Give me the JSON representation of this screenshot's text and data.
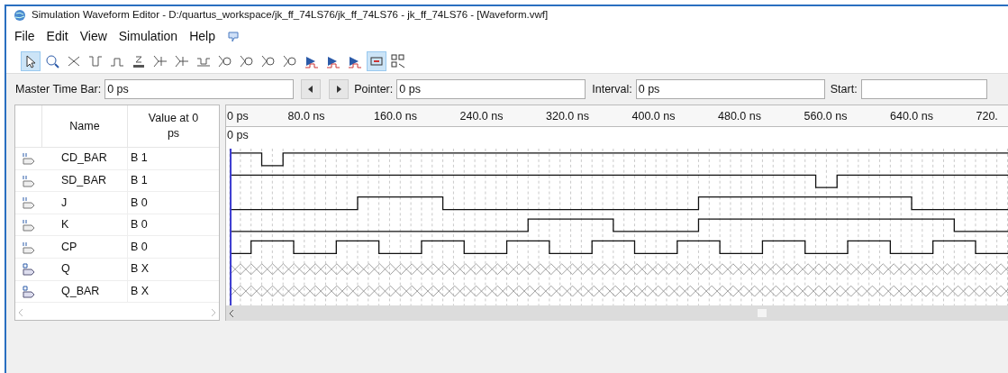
{
  "window": {
    "title": "Simulation Waveform Editor - D:/quartus_workspace/jk_ff_74LS76/jk_ff_74LS76 - jk_ff_74LS76 - [Waveform.vwf]"
  },
  "menu": [
    "File",
    "Edit",
    "View",
    "Simulation",
    "Help"
  ],
  "toolbar": [
    {
      "kind": "pointer",
      "selected": true
    },
    {
      "kind": "zoom",
      "selected": false
    },
    {
      "kind": "unknown",
      "selected": false
    },
    {
      "kind": "low",
      "selected": false
    },
    {
      "kind": "high",
      "selected": false
    },
    {
      "kind": "hiz",
      "selected": false
    },
    {
      "kind": "weak",
      "selected": false
    },
    {
      "kind": "weak",
      "selected": false
    },
    {
      "kind": "invert",
      "selected": false
    },
    {
      "kind": "bus",
      "selected": false
    },
    {
      "kind": "bus",
      "selected": false
    },
    {
      "kind": "bus",
      "selected": false
    },
    {
      "kind": "bus",
      "selected": false
    },
    {
      "kind": "sim",
      "selected": false
    },
    {
      "kind": "sim",
      "selected": false
    },
    {
      "kind": "sim",
      "selected": false
    },
    {
      "kind": "snap",
      "selected": true
    },
    {
      "kind": "grid",
      "selected": false
    }
  ],
  "time_bar": {
    "master_label": "Master Time Bar:",
    "master_value": "0 ps",
    "pointer_label": "Pointer:",
    "pointer_value": "0 ps",
    "interval_label": "Interval:",
    "interval_value": "0 ps",
    "start_label": "Start:"
  },
  "columns": [
    "Name",
    "Value at 0 ps"
  ],
  "timeline": [
    "0 ps",
    "80.0 ns",
    "160.0 ns",
    "240.0 ns",
    "320.0 ns",
    "400.0 ns",
    "480.0 ns",
    "560.0 ns",
    "640.0 ns",
    "720."
  ],
  "cursor_label": "0 ps",
  "signals": [
    {
      "kind": "input",
      "name": "CD_BAR",
      "value": "B 1"
    },
    {
      "kind": "input",
      "name": "SD_BAR",
      "value": "B 1"
    },
    {
      "kind": "input",
      "name": "J",
      "value": "B 0"
    },
    {
      "kind": "input",
      "name": "K",
      "value": "B 0"
    },
    {
      "kind": "input",
      "name": "CP",
      "value": "B 0"
    },
    {
      "kind": "output",
      "name": "Q",
      "value": "B X"
    },
    {
      "kind": "output",
      "name": "Q_BAR",
      "value": "B X"
    }
  ]
}
